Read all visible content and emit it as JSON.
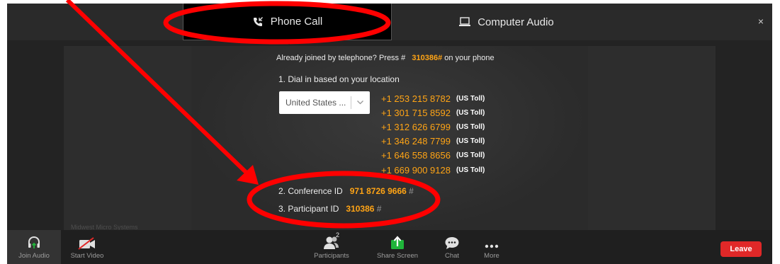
{
  "tabs": {
    "phone_call": "Phone Call",
    "computer_audio": "Computer Audio",
    "close": "×"
  },
  "already_joined": {
    "prefix": "Already joined by telephone? Press #",
    "code": "310386#",
    "suffix": "on your phone"
  },
  "step1": {
    "label": "1. Dial in based on your location",
    "country_select_value": "United States ...",
    "numbers": [
      {
        "number": "+1 253 215 8782",
        "type": "(US Toll)"
      },
      {
        "number": "+1 301 715 8592",
        "type": "(US Toll)"
      },
      {
        "number": "+1 312 626 6799",
        "type": "(US Toll)"
      },
      {
        "number": "+1 346 248 7799",
        "type": "(US Toll)"
      },
      {
        "number": "+1 646 558 8656",
        "type": "(US Toll)"
      },
      {
        "number": "+1 669 900 9128",
        "type": "(US Toll)"
      }
    ]
  },
  "step2": {
    "label": "2. Conference ID",
    "value": "971 8726 9666",
    "hash": "#"
  },
  "step3": {
    "label": "3. Participant ID",
    "value": "310386",
    "hash": "#"
  },
  "video_name": "Midwest Micro Systems",
  "toolbar": {
    "join_audio": "Join Audio",
    "start_video": "Start Video",
    "participants": "Participants",
    "participants_count": "2",
    "share_screen": "Share Screen",
    "chat": "Chat",
    "more": "More",
    "leave": "Leave"
  },
  "colors": {
    "accent_orange": "#ffa415",
    "leave_red": "#e02828",
    "share_green": "#1fb53a",
    "annotation_red": "#ff0000"
  },
  "icons": {
    "phone_tab": "phone-call-icon",
    "computer_tab": "laptop-icon",
    "join_audio": "headphones-icon",
    "start_video": "video-off-icon",
    "participants": "participants-icon",
    "share_screen": "share-screen-icon",
    "chat": "chat-bubble-icon",
    "more": "more-dots-icon"
  }
}
